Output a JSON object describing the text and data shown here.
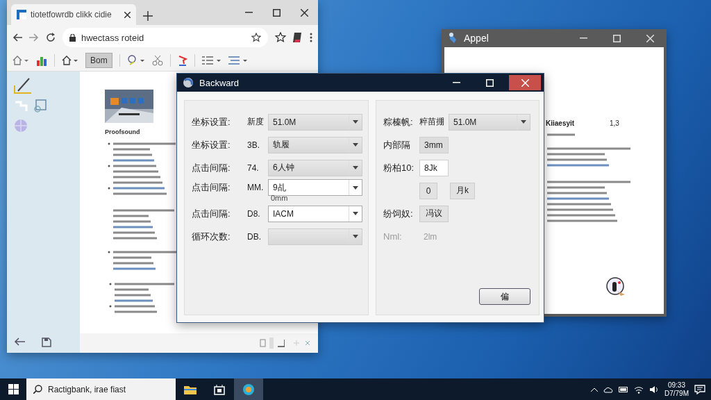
{
  "browser": {
    "tab_title": "tiotetfowrdb clikk cidie",
    "url": "hwectass roteid",
    "bookmark_button": "Bom",
    "document": {
      "heading": "Proofsound"
    }
  },
  "doc_window": {
    "title": "Appel",
    "heading": "Kiiaesyit",
    "page": "1,3"
  },
  "dialog": {
    "title": "Backward",
    "left_rows": [
      {
        "label": "坐标设置:",
        "prefix": "新度",
        "value": "51.0M",
        "editable": false
      },
      {
        "label": "坐标设置:",
        "prefix": "3B.",
        "value": "轨履",
        "editable": false
      },
      {
        "label": "点击间隔:",
        "prefix": "74.",
        "value": "6人钟",
        "editable": false
      },
      {
        "label": "点击间隔:",
        "prefix": "MM.",
        "value": "9乩",
        "editable": true,
        "hint": "0mm"
      },
      {
        "label": "点击间隔:",
        "prefix": "D8.",
        "value": "IACM",
        "editable": true
      },
      {
        "label": "循环次数:",
        "prefix": "DB.",
        "editable": false
      }
    ],
    "right_rows": [
      {
        "kind": "combo",
        "label": "粽榛帆:",
        "prefix": "粹苗掤",
        "value": "51.0M"
      },
      {
        "kind": "field",
        "label": "内部隔",
        "value": "3mm",
        "editable": false
      },
      {
        "kind": "field",
        "label": "粉柏10:",
        "value": "8Jk",
        "editable": true
      },
      {
        "kind": "buttons",
        "buttons": [
          "0",
          "月k"
        ]
      },
      {
        "kind": "button",
        "label": "纷饲奴:",
        "value": "冯议"
      },
      {
        "kind": "text",
        "label": "Nml:",
        "value": "2lm",
        "disabled": true
      }
    ],
    "button": "偏"
  },
  "taskbar": {
    "search": "Ractigbank, irae fiast",
    "time": "09:33",
    "date": "D7/79M"
  }
}
